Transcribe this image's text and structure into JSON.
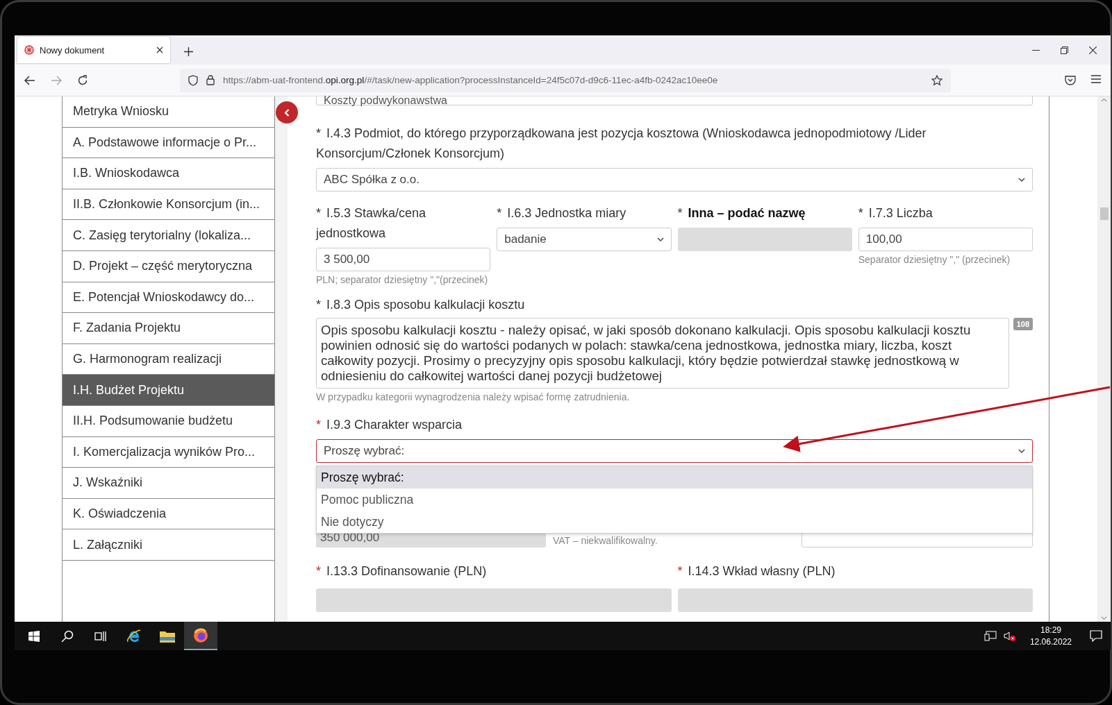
{
  "browser": {
    "tab": {
      "title": "Nowy dokument",
      "selected": true
    },
    "url": {
      "prefix": "https://abm-uat-frontend.",
      "domain": "opi.org.pl",
      "suffix": "/#/task/new-application?processInstanceId=24f5c07d-d9c6-11ec-a4fb-0242ac10ee0e"
    }
  },
  "sidebar": {
    "items": [
      {
        "label": "Metryka Wniosku",
        "selected": false
      },
      {
        "label": "A. Podstawowe informacje o Pr...",
        "selected": false
      },
      {
        "label": "I.B. Wnioskodawca",
        "selected": false
      },
      {
        "label": "II.B. Członkowie Konsorcjum (in...",
        "selected": false
      },
      {
        "label": "C. Zasięg terytorialny (lokaliza...",
        "selected": false
      },
      {
        "label": "D. Projekt – część merytoryczna",
        "selected": false
      },
      {
        "label": "E. Potencjał Wnioskodawcy do...",
        "selected": false
      },
      {
        "label": "F. Zadania Projektu",
        "selected": false
      },
      {
        "label": "G. Harmonogram realizacji",
        "selected": false
      },
      {
        "label": "I.H. Budżet Projektu",
        "selected": true
      },
      {
        "label": "II.H. Podsumowanie budżetu",
        "selected": false
      },
      {
        "label": "I. Komercjalizacja wyników Pro...",
        "selected": false
      },
      {
        "label": "J. Wskaźniki",
        "selected": false
      },
      {
        "label": "K. Oświadczenia",
        "selected": false
      },
      {
        "label": "L. Załączniki",
        "selected": false
      }
    ]
  },
  "form": {
    "top_field": {
      "value": "Koszty podwykonawstwa"
    },
    "entity": {
      "asterisk": "*",
      "red": false,
      "label": "I.4.3 Podmiot, do którego przyporządkowana jest pozycja kosztowa (Wnioskodawca jednopodmiotowy /Lider Konsorcjum/Członek Konsorcjum)",
      "value": "ABC Spółka z o.o."
    },
    "unit_row": [
      {
        "kind": "input",
        "asterisk": "*",
        "red": false,
        "bold": false,
        "label": "I.5.3 Stawka/cena jednostkowa",
        "value": "3 500,00",
        "hint": "PLN; separator dziesiętny \",\"(przecinek)"
      },
      {
        "kind": "select",
        "asterisk": "*",
        "red": false,
        "bold": false,
        "label": "I.6.3 Jednostka miary",
        "value": "badanie"
      },
      {
        "kind": "disabled",
        "asterisk": "*",
        "red": false,
        "bold": true,
        "label": "Inna – podać nazwę"
      },
      {
        "kind": "input",
        "asterisk": "*",
        "red": false,
        "bold": false,
        "label": "I.7.3 Liczba",
        "value": "100,00",
        "hint": "Separator dziesiętny \",\" (przecinek)"
      }
    ],
    "description": {
      "asterisk": "*",
      "red": false,
      "label": "I.8.3 Opis sposobu kalkulacji kosztu",
      "value": "Opis sposobu kalkulacji kosztu - należy opisać, w jaki sposób dokonano kalkulacji. Opis sposobu kalkulacji kosztu powinien odnosić się do wartości podanych w polach: stawka/cena jednostkowa, jednostka miary, liczba, koszt całkowity pozycji. Prosimy o precyzyjny opis sposobu kalkulacji, który będzie potwierdzał stawkę jednostkową w odniesieniu do całkowitej wartości danej pozycji budżetowej",
      "counter": "108",
      "hint": "W przypadku kategorii wynagrodzenia należy wpisać formę zatrudnienia."
    },
    "support": {
      "asterisk": "*",
      "red": true,
      "invalid": true,
      "label": "I.9.3 Charakter wsparcia",
      "value": "Proszę wybrać:",
      "expanded": true,
      "options": [
        {
          "label": "Proszę wybrać:",
          "selected": true
        },
        {
          "label": "Pomoc publiczna",
          "selected": false
        },
        {
          "label": "Nie dotyczy",
          "selected": false
        }
      ]
    },
    "cost_row": {
      "value": "350 000,00",
      "hint": "VAT – niekwalifikowalny."
    },
    "funding_row": [
      {
        "asterisk": "*",
        "red": true,
        "label": "I.13.3 Dofinansowanie (PLN)"
      },
      {
        "asterisk": "*",
        "red": true,
        "label": "I.14.3 Wkład własny (PLN)"
      }
    ]
  },
  "taskbar": {
    "time": "18:29",
    "date": "12.06.2022"
  }
}
